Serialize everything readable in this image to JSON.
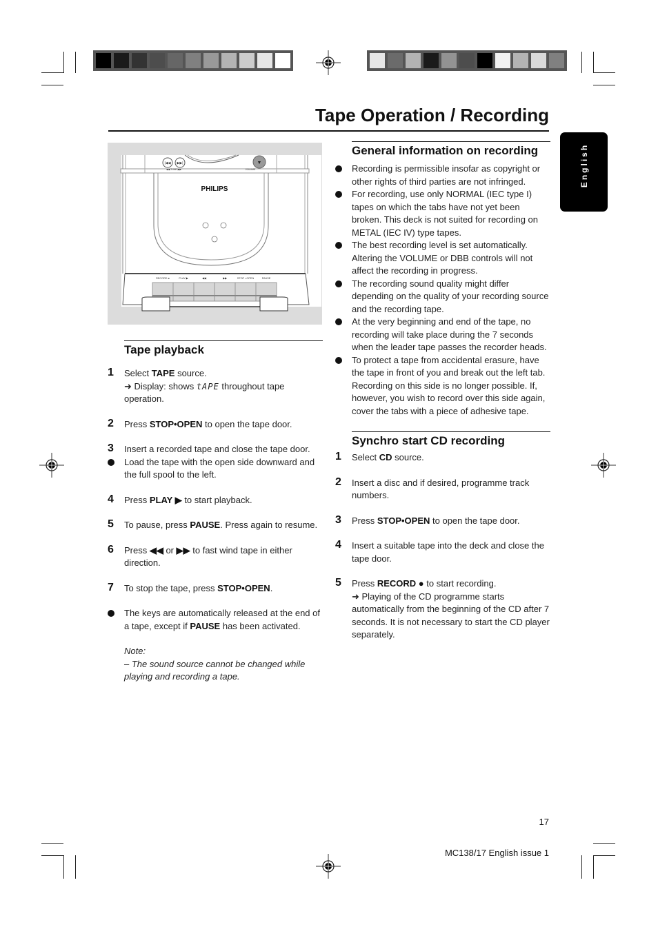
{
  "print_marks": {
    "left_swatches": [
      "#000000",
      "#1a1a1a",
      "#333333",
      "#4d4d4d",
      "#666666",
      "#808080",
      "#999999",
      "#b3b3b3",
      "#cccccc",
      "#e6e6e6",
      "#ffffff"
    ],
    "right_swatches": [
      "#e6e6e6",
      "#6b6b6b",
      "#b3b3b3",
      "#1a1a1a",
      "#939393",
      "#4d4d4d",
      "#000000",
      "#f2f2f2",
      "#b3b3b3",
      "#d9d9d9",
      "#808080"
    ]
  },
  "header": {
    "title": "Tape Operation / Recording"
  },
  "language_tab": {
    "label": "English"
  },
  "illustration": {
    "brand": "PHILIPS",
    "top_labels": {
      "tuning": "◀◀ TUNE ▶▶",
      "volume": "VOLUME"
    },
    "deck_buttons": [
      "RECORD ●",
      "PLAY ▶",
      "◀◀",
      "▶▶",
      "STOP • OPEN",
      "PAUSE"
    ]
  },
  "tape_playback": {
    "title": "Tape playback",
    "steps": [
      {
        "num": "1",
        "pre": "Select ",
        "bold": "TAPE",
        "post": " source.",
        "sub_pre": "➜ Display: shows ",
        "display": "tAPE",
        "sub_post": " throughout tape operation."
      },
      {
        "num": "2",
        "pre": "Press ",
        "bold": "STOP•OPEN",
        "post": " to open the tape door."
      },
      {
        "num": "3",
        "text": "Insert a recorded tape and close the tape door."
      },
      {
        "bullet": true,
        "text": "Load the tape with the open side downward and the full spool to the left."
      },
      {
        "num": "4",
        "pre": "Press ",
        "bold": "PLAY ▶",
        "post": " to start playback."
      },
      {
        "num": "5",
        "pre": "To pause, press ",
        "bold": "PAUSE",
        "post": ". Press again to resume."
      },
      {
        "num": "6",
        "pre": "Press ",
        "bold": "◀◀",
        "mid": " or ",
        "bold2": "▶▶",
        "post": " to fast wind tape in either direction."
      },
      {
        "num": "7",
        "pre": "To stop the tape, press ",
        "bold": "STOP•OPEN",
        "post": "."
      },
      {
        "bullet": true,
        "pre": "The keys are automatically released at the end of a tape, except if ",
        "bold": "PAUSE",
        "post": " has been activated."
      }
    ],
    "note_label": "Note:",
    "note_text": "–  The sound source cannot be changed while playing and recording a tape."
  },
  "general_info": {
    "title": "General information on recording",
    "bullets": [
      "Recording is permissible insofar as copyright or other rights of third parties are not infringed.",
      "For recording, use only NORMAL (IEC type I) tapes on which the tabs have not yet been broken. This deck is not suited for recording on METAL (IEC IV) type tapes.",
      "The best recording level is set automatically. Altering the VOLUME or DBB controls will not affect the recording in progress.",
      "The recording sound quality might differ depending on the quality of your recording source and the recording tape.",
      "At the very beginning and end of the tape, no recording will take place during the 7 seconds when the leader tape passes the recorder heads.",
      "To protect a tape from accidental erasure, have the tape in front of you and break out the left tab. Recording on this side is no longer possible. If, however, you wish to record over this side again, cover the tabs with a piece of adhesive tape."
    ]
  },
  "synchro": {
    "title": "Synchro start CD recording",
    "steps": [
      {
        "num": "1",
        "pre": "Select ",
        "bold": "CD",
        "post": " source."
      },
      {
        "num": "2",
        "text": "Insert a disc and if desired, programme track numbers."
      },
      {
        "num": "3",
        "pre": "Press ",
        "bold": "STOP•OPEN",
        "post": " to open the tape door."
      },
      {
        "num": "4",
        "text": "Insert a suitable tape into the deck and close the tape door."
      },
      {
        "num": "5",
        "pre": "Press ",
        "bold": "RECORD ●",
        "post": " to start recording.",
        "sub": "➜ Playing of the CD programme starts automatically from the beginning of the CD after 7 seconds. It is not necessary to start the CD player separately."
      }
    ]
  },
  "footer": {
    "page_number": "17",
    "doc_code": "MC138/17 English issue 1"
  }
}
